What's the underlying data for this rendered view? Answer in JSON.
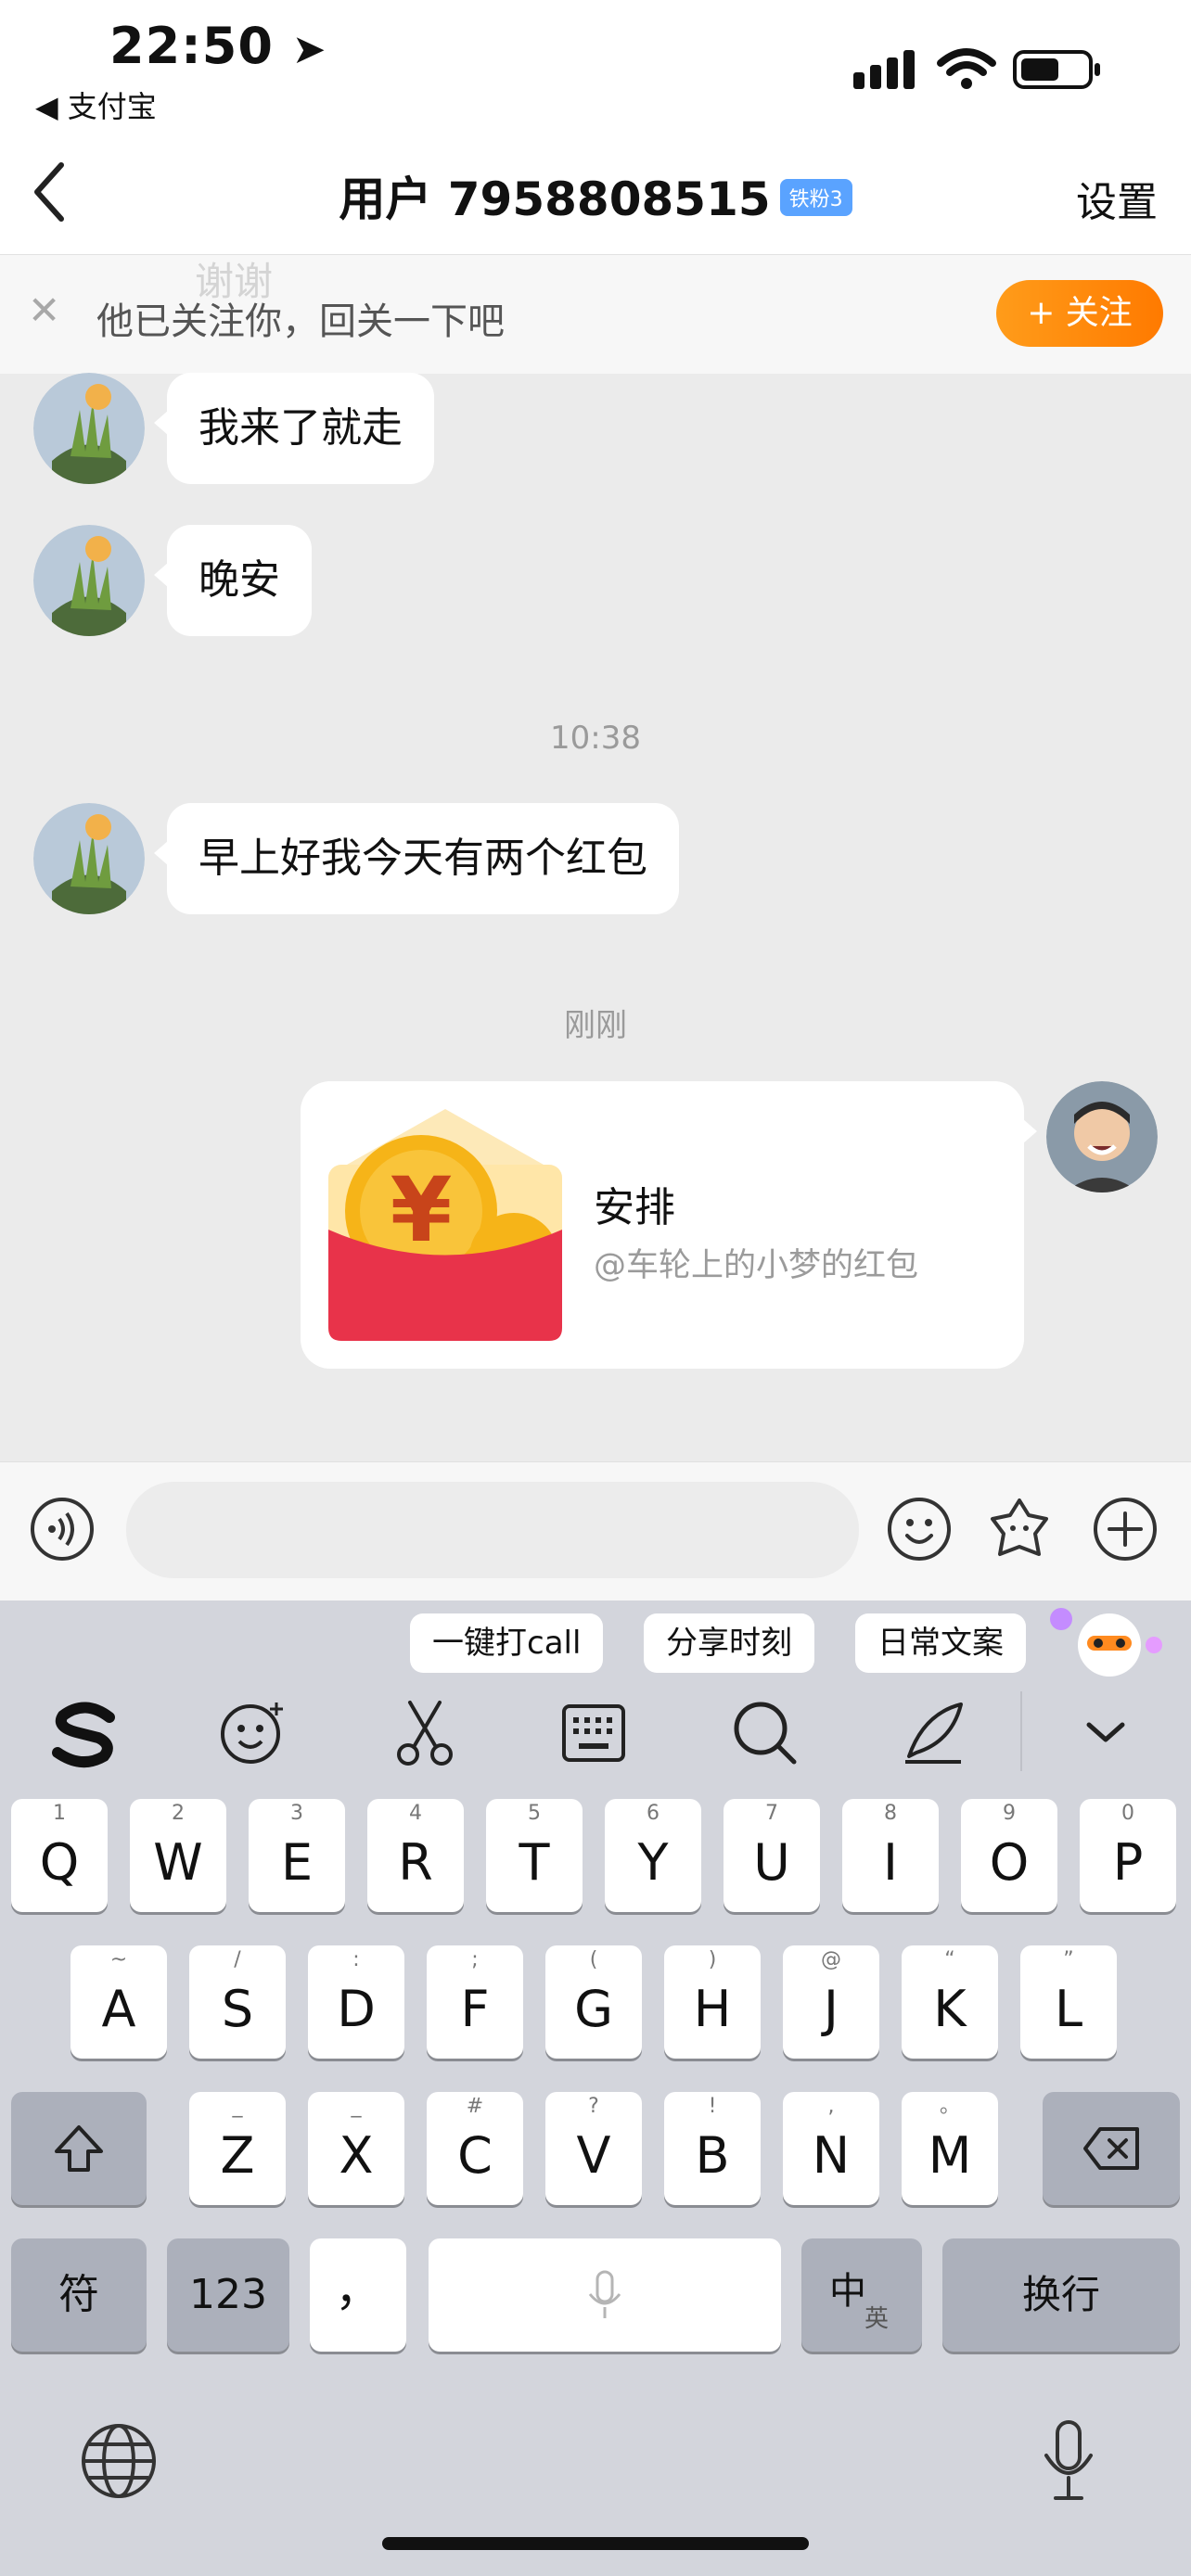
{
  "status_bar": {
    "time": "22:50",
    "back_app": "支付宝"
  },
  "nav": {
    "title": "用户 7958808515",
    "badge": "铁粉3",
    "settings": "设置"
  },
  "follow_banner": {
    "faded_message": "谢谢",
    "text": "他已关注你，回关一下吧",
    "button": "+ 关注"
  },
  "messages": [
    {
      "from": "other",
      "text": "我来了就走"
    },
    {
      "from": "other",
      "text": "晚安"
    },
    {
      "timestamp": "10:38"
    },
    {
      "from": "other",
      "text": "早上好我今天有两个红包"
    },
    {
      "timestamp": "刚刚"
    },
    {
      "from": "me",
      "type": "red_packet",
      "title": "安排",
      "subtitle": "@车轮上的小梦的红包"
    }
  ],
  "input": {
    "placeholder": ""
  },
  "keyboard": {
    "suggestions": [
      "一键打call",
      "分享时刻",
      "日常文案"
    ],
    "row1": [
      [
        "1",
        "Q"
      ],
      [
        "2",
        "W"
      ],
      [
        "3",
        "E"
      ],
      [
        "4",
        "R"
      ],
      [
        "5",
        "T"
      ],
      [
        "6",
        "Y"
      ],
      [
        "7",
        "U"
      ],
      [
        "8",
        "I"
      ],
      [
        "9",
        "O"
      ],
      [
        "0",
        "P"
      ]
    ],
    "row2": [
      [
        "~",
        "A"
      ],
      [
        "/",
        "S"
      ],
      [
        ":",
        "D"
      ],
      [
        ";",
        "F"
      ],
      [
        "(",
        "G"
      ],
      [
        ")",
        "H"
      ],
      [
        "@",
        "J"
      ],
      [
        "“",
        "K"
      ],
      [
        "”",
        "L"
      ]
    ],
    "row3": [
      [
        "_",
        "Z"
      ],
      [
        "_",
        "X"
      ],
      [
        "#",
        "C"
      ],
      [
        "?",
        "V"
      ],
      [
        "!",
        "B"
      ],
      [
        ",",
        "N"
      ],
      [
        "。",
        "M"
      ]
    ],
    "row4": {
      "symbols": "符",
      "numbers": "123",
      "comma": "，",
      "lang_main": "中",
      "lang_sub": "英",
      "return": "换行"
    }
  }
}
